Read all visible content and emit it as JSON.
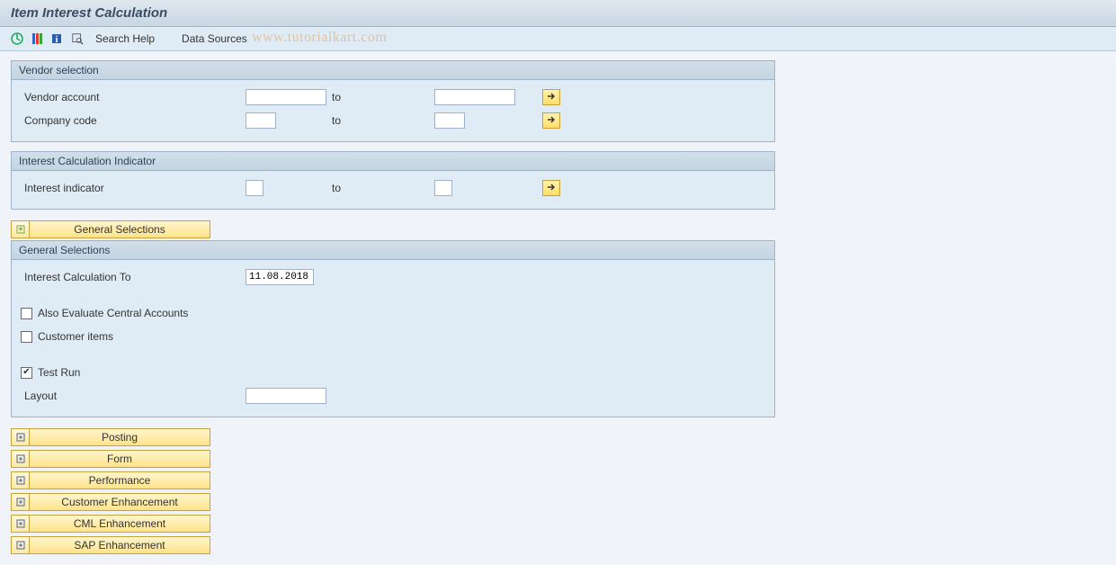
{
  "title": "Item Interest Calculation",
  "toolbar": {
    "search_help": "Search Help",
    "data_sources": "Data Sources"
  },
  "watermark": "www.tutorialkart.com",
  "vendor_selection": {
    "title": "Vendor selection",
    "vendor_account": {
      "label": "Vendor account",
      "from": "",
      "to_label": "to",
      "to": ""
    },
    "company_code": {
      "label": "Company code",
      "from": "",
      "to_label": "to",
      "to": ""
    }
  },
  "interest_indicator_group": {
    "title": "Interest Calculation Indicator",
    "interest_indicator": {
      "label": "Interest indicator",
      "from": "",
      "to_label": "to",
      "to": ""
    }
  },
  "general_selections": {
    "tab_label": "General Selections",
    "title": "General Selections",
    "interest_calc_to": {
      "label": "Interest Calculation To",
      "value": "11.08.2018"
    },
    "also_evaluate_central": {
      "label": "Also Evaluate Central Accounts",
      "checked": false
    },
    "customer_items": {
      "label": "Customer items",
      "checked": false
    },
    "test_run": {
      "label": "Test Run",
      "checked": true
    },
    "layout": {
      "label": "Layout",
      "value": ""
    }
  },
  "tabs": {
    "posting": "Posting",
    "form": "Form",
    "performance": "Performance",
    "customer_enh": "Customer Enhancement",
    "cml_enh": "CML Enhancement",
    "sap_enh": "SAP Enhancement"
  }
}
